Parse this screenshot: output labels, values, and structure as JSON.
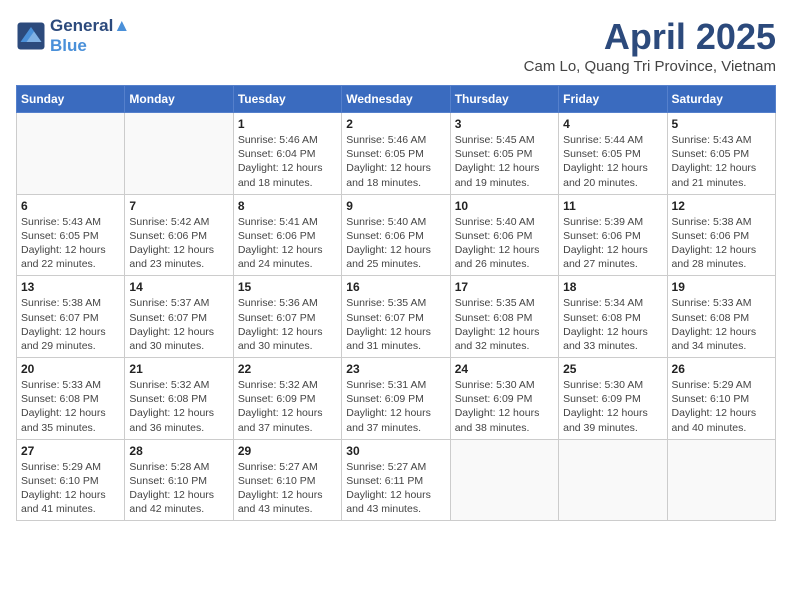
{
  "header": {
    "logo_line1": "General",
    "logo_line2": "Blue",
    "month_title": "April 2025",
    "location": "Cam Lo, Quang Tri Province, Vietnam"
  },
  "days_of_week": [
    "Sunday",
    "Monday",
    "Tuesday",
    "Wednesday",
    "Thursday",
    "Friday",
    "Saturday"
  ],
  "weeks": [
    [
      {
        "day": "",
        "info": ""
      },
      {
        "day": "",
        "info": ""
      },
      {
        "day": "1",
        "info": "Sunrise: 5:46 AM\nSunset: 6:04 PM\nDaylight: 12 hours\nand 18 minutes."
      },
      {
        "day": "2",
        "info": "Sunrise: 5:46 AM\nSunset: 6:05 PM\nDaylight: 12 hours\nand 18 minutes."
      },
      {
        "day": "3",
        "info": "Sunrise: 5:45 AM\nSunset: 6:05 PM\nDaylight: 12 hours\nand 19 minutes."
      },
      {
        "day": "4",
        "info": "Sunrise: 5:44 AM\nSunset: 6:05 PM\nDaylight: 12 hours\nand 20 minutes."
      },
      {
        "day": "5",
        "info": "Sunrise: 5:43 AM\nSunset: 6:05 PM\nDaylight: 12 hours\nand 21 minutes."
      }
    ],
    [
      {
        "day": "6",
        "info": "Sunrise: 5:43 AM\nSunset: 6:05 PM\nDaylight: 12 hours\nand 22 minutes."
      },
      {
        "day": "7",
        "info": "Sunrise: 5:42 AM\nSunset: 6:06 PM\nDaylight: 12 hours\nand 23 minutes."
      },
      {
        "day": "8",
        "info": "Sunrise: 5:41 AM\nSunset: 6:06 PM\nDaylight: 12 hours\nand 24 minutes."
      },
      {
        "day": "9",
        "info": "Sunrise: 5:40 AM\nSunset: 6:06 PM\nDaylight: 12 hours\nand 25 minutes."
      },
      {
        "day": "10",
        "info": "Sunrise: 5:40 AM\nSunset: 6:06 PM\nDaylight: 12 hours\nand 26 minutes."
      },
      {
        "day": "11",
        "info": "Sunrise: 5:39 AM\nSunset: 6:06 PM\nDaylight: 12 hours\nand 27 minutes."
      },
      {
        "day": "12",
        "info": "Sunrise: 5:38 AM\nSunset: 6:06 PM\nDaylight: 12 hours\nand 28 minutes."
      }
    ],
    [
      {
        "day": "13",
        "info": "Sunrise: 5:38 AM\nSunset: 6:07 PM\nDaylight: 12 hours\nand 29 minutes."
      },
      {
        "day": "14",
        "info": "Sunrise: 5:37 AM\nSunset: 6:07 PM\nDaylight: 12 hours\nand 30 minutes."
      },
      {
        "day": "15",
        "info": "Sunrise: 5:36 AM\nSunset: 6:07 PM\nDaylight: 12 hours\nand 30 minutes."
      },
      {
        "day": "16",
        "info": "Sunrise: 5:35 AM\nSunset: 6:07 PM\nDaylight: 12 hours\nand 31 minutes."
      },
      {
        "day": "17",
        "info": "Sunrise: 5:35 AM\nSunset: 6:08 PM\nDaylight: 12 hours\nand 32 minutes."
      },
      {
        "day": "18",
        "info": "Sunrise: 5:34 AM\nSunset: 6:08 PM\nDaylight: 12 hours\nand 33 minutes."
      },
      {
        "day": "19",
        "info": "Sunrise: 5:33 AM\nSunset: 6:08 PM\nDaylight: 12 hours\nand 34 minutes."
      }
    ],
    [
      {
        "day": "20",
        "info": "Sunrise: 5:33 AM\nSunset: 6:08 PM\nDaylight: 12 hours\nand 35 minutes."
      },
      {
        "day": "21",
        "info": "Sunrise: 5:32 AM\nSunset: 6:08 PM\nDaylight: 12 hours\nand 36 minutes."
      },
      {
        "day": "22",
        "info": "Sunrise: 5:32 AM\nSunset: 6:09 PM\nDaylight: 12 hours\nand 37 minutes."
      },
      {
        "day": "23",
        "info": "Sunrise: 5:31 AM\nSunset: 6:09 PM\nDaylight: 12 hours\nand 37 minutes."
      },
      {
        "day": "24",
        "info": "Sunrise: 5:30 AM\nSunset: 6:09 PM\nDaylight: 12 hours\nand 38 minutes."
      },
      {
        "day": "25",
        "info": "Sunrise: 5:30 AM\nSunset: 6:09 PM\nDaylight: 12 hours\nand 39 minutes."
      },
      {
        "day": "26",
        "info": "Sunrise: 5:29 AM\nSunset: 6:10 PM\nDaylight: 12 hours\nand 40 minutes."
      }
    ],
    [
      {
        "day": "27",
        "info": "Sunrise: 5:29 AM\nSunset: 6:10 PM\nDaylight: 12 hours\nand 41 minutes."
      },
      {
        "day": "28",
        "info": "Sunrise: 5:28 AM\nSunset: 6:10 PM\nDaylight: 12 hours\nand 42 minutes."
      },
      {
        "day": "29",
        "info": "Sunrise: 5:27 AM\nSunset: 6:10 PM\nDaylight: 12 hours\nand 43 minutes."
      },
      {
        "day": "30",
        "info": "Sunrise: 5:27 AM\nSunset: 6:11 PM\nDaylight: 12 hours\nand 43 minutes."
      },
      {
        "day": "",
        "info": ""
      },
      {
        "day": "",
        "info": ""
      },
      {
        "day": "",
        "info": ""
      }
    ]
  ]
}
